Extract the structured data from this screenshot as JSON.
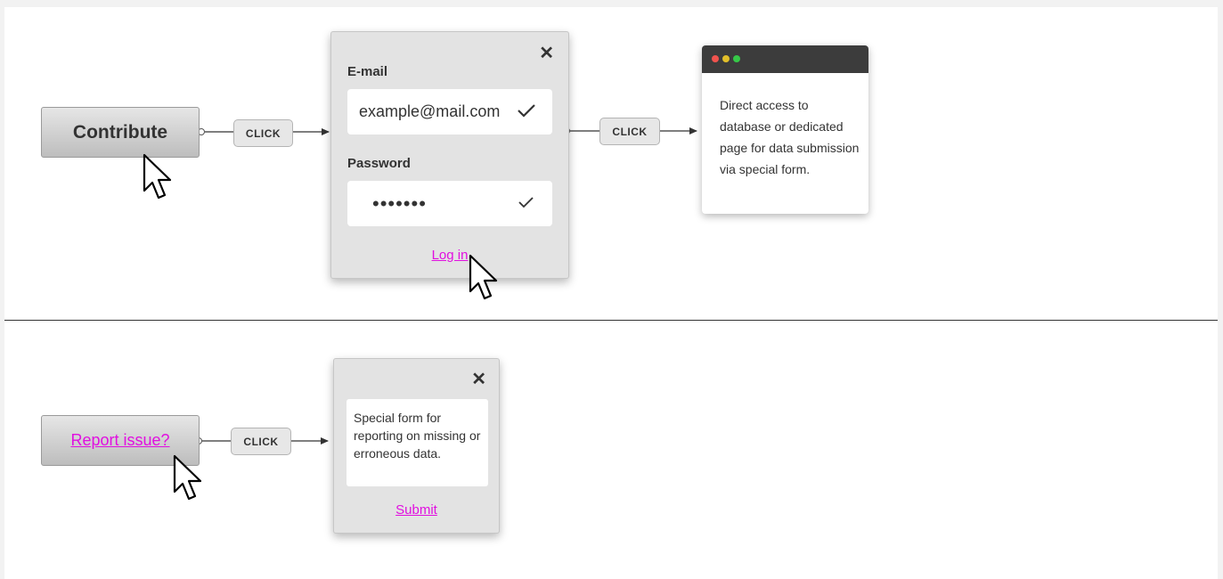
{
  "flow_top": {
    "trigger_button": "Contribute",
    "click_label_1": "CLICK",
    "login_dialog": {
      "email_label": "E-mail",
      "email_value": "example@mail.com",
      "password_label": "Password",
      "password_value": "•••••••",
      "login_link": "Log in"
    },
    "click_label_2": "CLICK",
    "result_window": {
      "text": "Direct access to database or dedicated page for data submission via special form."
    }
  },
  "flow_bottom": {
    "trigger_link": "Report issue?",
    "click_label": "CLICK",
    "report_dialog": {
      "text": "Special form for reporting on missing or erroneous data.",
      "submit_link": "Submit"
    }
  },
  "icons": {
    "close": "close-icon",
    "check": "check-icon",
    "cursor": "pointer-cursor-icon",
    "window_dots": [
      "#f0534e",
      "#e2bf2a",
      "#36c848"
    ]
  },
  "colors": {
    "link": "#e10fe0",
    "panel": "#e3e3e3",
    "titlebar": "#3c3c3c"
  }
}
